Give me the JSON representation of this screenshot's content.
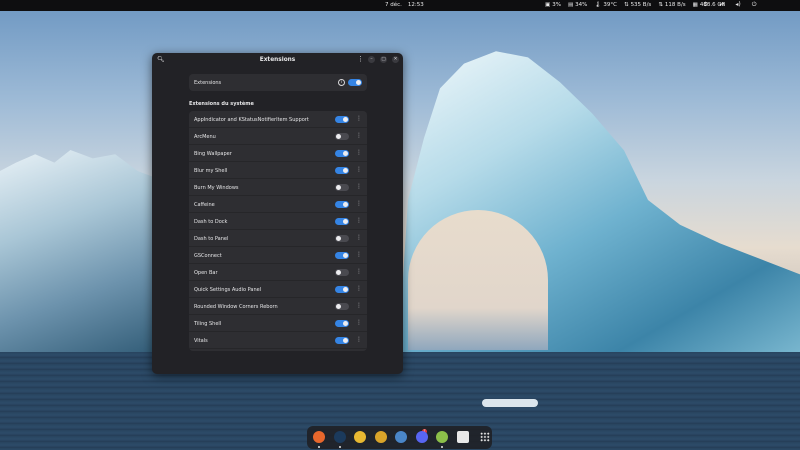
{
  "topbar": {
    "date": "7 déc.",
    "time": "12:53",
    "stats": [
      {
        "icon": "cpu-icon",
        "value": "3%"
      },
      {
        "icon": "memory-icon",
        "value": "34%"
      },
      {
        "icon": "temperature-icon",
        "value": "39°C"
      },
      {
        "icon": "download-icon",
        "value": "535 B/s"
      },
      {
        "icon": "upload-icon",
        "value": "118 B/s"
      },
      {
        "icon": "disk-icon",
        "value": "433.6 GB"
      }
    ],
    "tray": [
      "settings-icon",
      "network-icon",
      "volume-icon",
      "power-icon"
    ]
  },
  "window": {
    "title": "Extensions",
    "main_toggle": {
      "label": "Extensions",
      "on": true
    },
    "section_title": "Extensions du système",
    "extensions": [
      {
        "name": "AppIndicator and KStatusNotifierItem Support",
        "on": true
      },
      {
        "name": "ArcMenu",
        "on": false
      },
      {
        "name": "Bing Wallpaper",
        "on": true
      },
      {
        "name": "Blur my Shell",
        "on": true
      },
      {
        "name": "Burn My Windows",
        "on": false
      },
      {
        "name": "Caffeine",
        "on": true
      },
      {
        "name": "Dash to Dock",
        "on": true
      },
      {
        "name": "Dash to Panel",
        "on": false
      },
      {
        "name": "GSConnect",
        "on": true
      },
      {
        "name": "Open Bar",
        "on": false
      },
      {
        "name": "Quick Settings Audio Panel",
        "on": true
      },
      {
        "name": "Rounded Window Corners Reborn",
        "on": false
      },
      {
        "name": "Tiling Shell",
        "on": true
      },
      {
        "name": "Vitals",
        "on": true
      }
    ]
  },
  "dock": {
    "apps": [
      {
        "icon": "firefox-icon",
        "color": "#e8672c",
        "running": true
      },
      {
        "icon": "steam-icon",
        "color": "#1b3a5c",
        "running": true
      },
      {
        "icon": "gnome-tweaks-icon",
        "color": "#e8b832",
        "running": false
      },
      {
        "icon": "brush-icon",
        "color": "#d9a42a",
        "running": false
      },
      {
        "icon": "files-icon",
        "color": "#4a86c8",
        "running": false
      },
      {
        "icon": "discord-icon",
        "color": "#5865f2",
        "running": false
      },
      {
        "icon": "extensions-icon",
        "color": "#8cbf4a",
        "running": true
      },
      {
        "icon": "document-viewer-icon",
        "color": "#e8e8e8",
        "running": false
      }
    ],
    "discord_badge": "7"
  }
}
